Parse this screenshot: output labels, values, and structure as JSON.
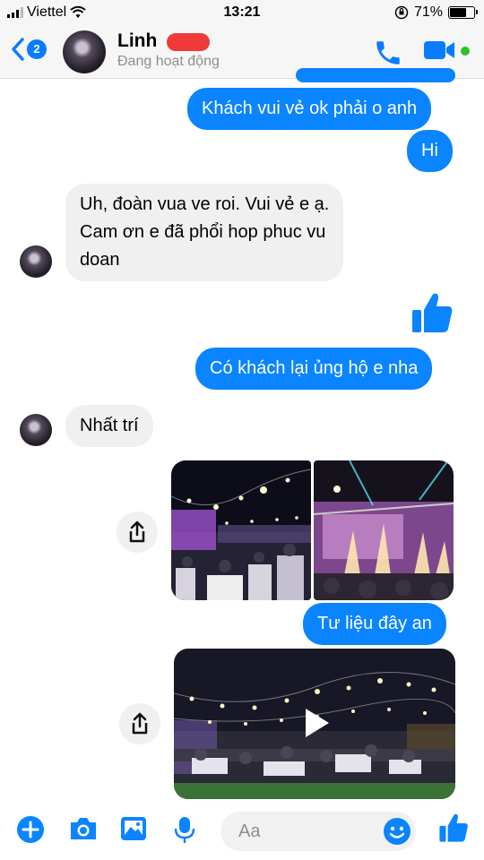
{
  "status_bar": {
    "carrier": "Viettel",
    "time": "13:21",
    "battery": "71%",
    "battery_level": 0.71
  },
  "header": {
    "back_count": "2",
    "contact_name": "Linh",
    "contact_status": "Đang hoạt động"
  },
  "messages": {
    "m1": "Khách vui vẻ ok phải o anh",
    "m2": "Hi",
    "m3_line1": "Uh, đoàn vua ve roi. Vui vẻ e ạ.",
    "m3_line2": "Cam ơn e đã phổi hop phuc vu",
    "m3_line3": "doan",
    "m5": "Có khách lại ủng hộ e nha",
    "m6": "Nhất trí",
    "m8": "Tư liệu đây an"
  },
  "composer": {
    "placeholder": "Aa"
  },
  "colors": {
    "accent": "#0a84ff",
    "incoming_bubble": "#f1f0f0",
    "online": "#2ac12a"
  },
  "icons": [
    "back-chevron-icon",
    "phone-icon",
    "video-camera-icon",
    "thumbs-up-icon",
    "share-icon",
    "play-icon",
    "plus-icon",
    "camera-icon",
    "image-icon",
    "microphone-icon",
    "emoji-icon",
    "like-icon"
  ]
}
